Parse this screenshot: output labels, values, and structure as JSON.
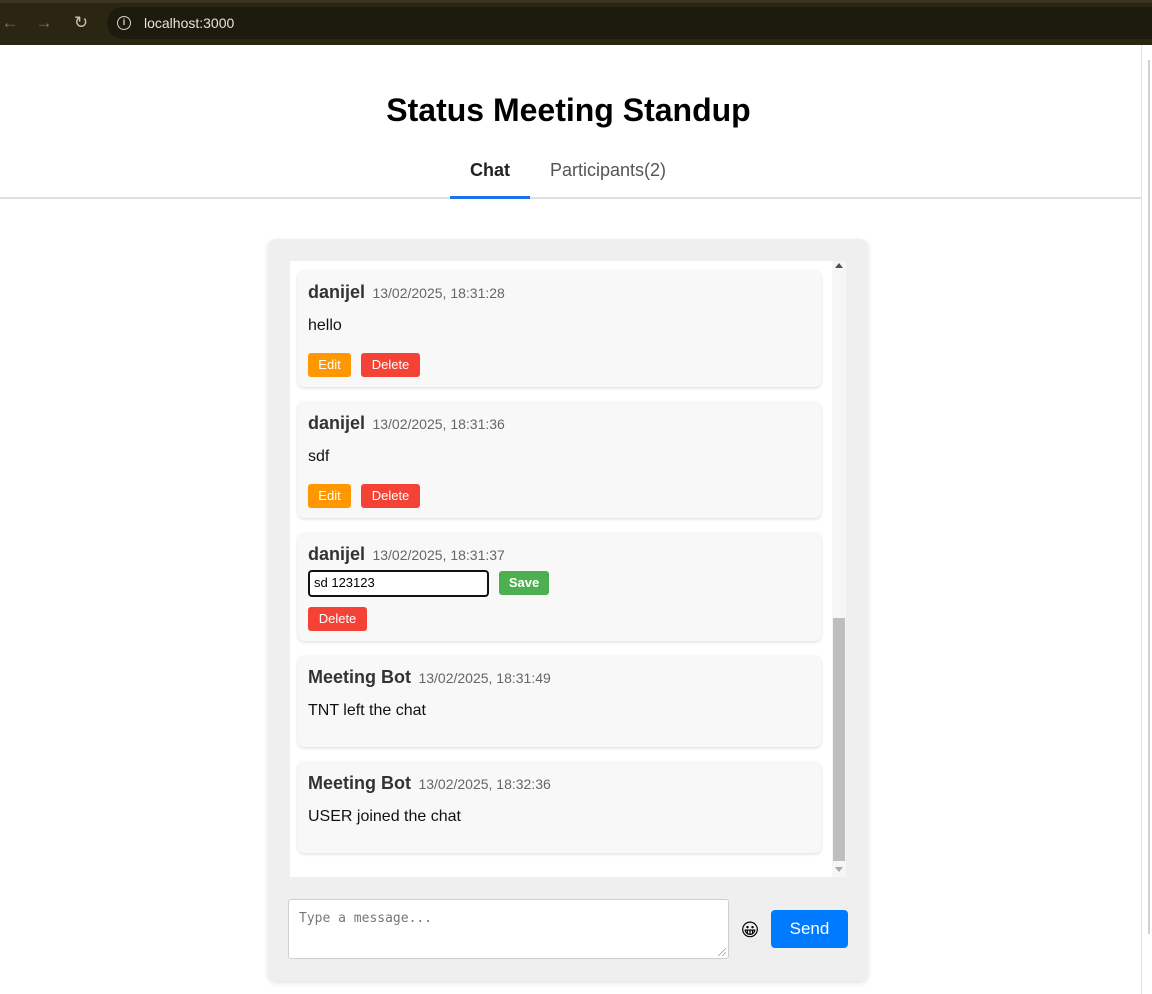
{
  "browser": {
    "url": "localhost:3000",
    "back_icon": "←",
    "forward_icon": "→",
    "reload_icon": "↻",
    "info_icon": "i"
  },
  "page": {
    "title": "Status Meeting Standup",
    "tabs": [
      {
        "label": "Chat",
        "active": true
      },
      {
        "label": "Participants(2)",
        "active": false
      }
    ]
  },
  "messages": [
    {
      "author": "danijel",
      "timestamp": "13/02/2025, 18:31:28",
      "text": "hello",
      "edit_label": "Edit",
      "delete_label": "Delete"
    },
    {
      "author": "danijel",
      "timestamp": "13/02/2025, 18:31:36",
      "text": "sdf",
      "edit_label": "Edit",
      "delete_label": "Delete"
    },
    {
      "author": "danijel",
      "timestamp": "13/02/2025, 18:31:37",
      "editing_value": "sd 123123",
      "save_label": "Save",
      "delete_label": "Delete"
    },
    {
      "author": "Meeting Bot",
      "timestamp": "13/02/2025, 18:31:49",
      "text": "TNT left the chat"
    },
    {
      "author": "Meeting Bot",
      "timestamp": "13/02/2025, 18:32:36",
      "text": "USER joined the chat"
    }
  ],
  "composer": {
    "placeholder": "Type a message...",
    "emoji": "😀",
    "send_label": "Send"
  },
  "colors": {
    "edit": "#ff9800",
    "delete": "#f44336",
    "save": "#4caf50",
    "send": "#007bff",
    "active_tab": "#1a73e8"
  }
}
